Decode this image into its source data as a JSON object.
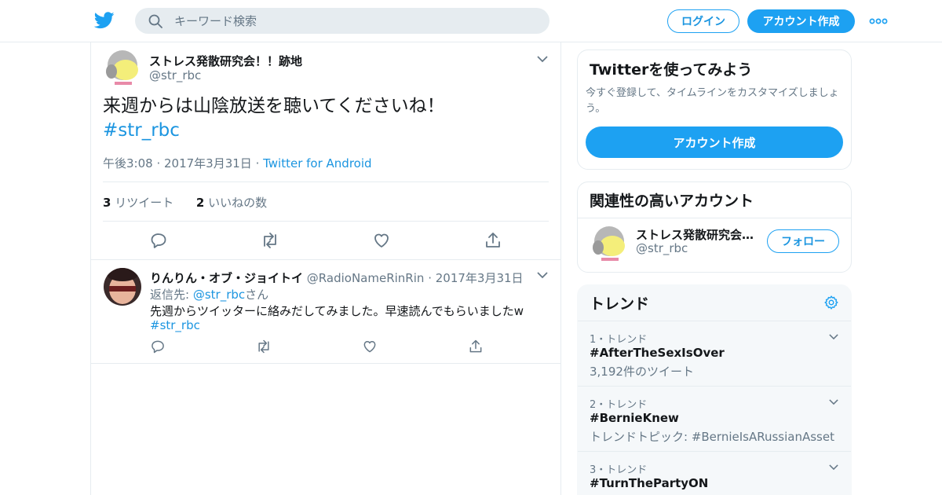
{
  "header": {
    "search_placeholder": "キーワード検索",
    "login_label": "ログイン",
    "signup_label": "アカウント作成"
  },
  "colors": {
    "accent": "#1da1f2",
    "link": "#1b95e0",
    "muted": "#657786",
    "border": "#e6ecf0"
  },
  "tweet": {
    "display_name": "ストレス発散研究会！！跡地",
    "handle": "@str_rbc",
    "text": "来週からは山陰放送を聴いてくださいね！",
    "hashtag": "#str_rbc",
    "timestamp": "午後3:08 · 2017年3月31日",
    "source_sep": " · ",
    "source": "Twitter for Android",
    "retweet_count": "3",
    "retweet_label": "リツイート",
    "like_count": "2",
    "like_label": "いいねの数"
  },
  "reply": {
    "display_name": "りんりん・オブ・ジョイトイ",
    "handle": "@RadioNameRinRin",
    "date": "2017年3月31日",
    "reply_to_prefix": "返信先: ",
    "reply_to_mention": "@str_rbc",
    "reply_to_suffix": "さん",
    "text": "先週からツイッターに絡みだしてみました。早速読んでもらいましたw",
    "hashtag": "#str_rbc"
  },
  "sidebar": {
    "signup_card": {
      "title": "Twitterを使ってみよう",
      "description": "今すぐ登録して、タイムラインをカスタマイズしましょう。",
      "button_label": "アカウント作成"
    },
    "related": {
      "title": "関連性の高いアカウント",
      "display_name": "ストレス発散研究会！！跡地",
      "handle": "@str_rbc",
      "follow_label": "フォロー"
    },
    "trends": {
      "title": "トレンド",
      "items": [
        {
          "rank": "1・トレンド",
          "name": "#AfterTheSexIsOver",
          "sub": "3,192件のツイート"
        },
        {
          "rank": "2・トレンド",
          "name": "#BernieKnew",
          "sub": "トレンドトピック: #BernieIsARussianAsset"
        },
        {
          "rank": "3・トレンド",
          "name": "#TurnThePartyON",
          "sub": ""
        }
      ]
    }
  }
}
